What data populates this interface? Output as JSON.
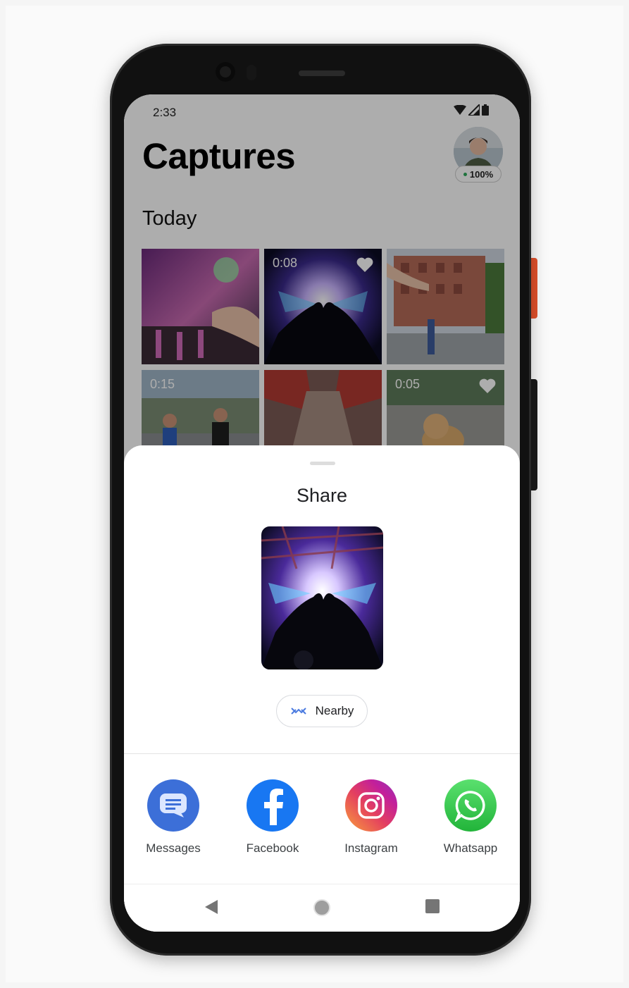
{
  "status": {
    "time": "2:33"
  },
  "app": {
    "title": "Captures",
    "battery": "100%",
    "section": "Today",
    "thumbs": [
      {
        "duration": "",
        "favorite": false
      },
      {
        "duration": "0:08",
        "favorite": true
      },
      {
        "duration": "",
        "favorite": false
      },
      {
        "duration": "0:15",
        "favorite": false
      },
      {
        "duration": "",
        "favorite": false
      },
      {
        "duration": "0:05",
        "favorite": true
      }
    ]
  },
  "share": {
    "title": "Share",
    "nearby_label": "Nearby",
    "apps": [
      {
        "label": "Messages",
        "icon": "messages-icon",
        "color": "#3c6fd8"
      },
      {
        "label": "Facebook",
        "icon": "facebook-icon",
        "color": "#1877f2"
      },
      {
        "label": "Instagram",
        "icon": "instagram-icon",
        "color": "#d6249f"
      },
      {
        "label": "Whatsapp",
        "icon": "whatsapp-icon",
        "color": "#25d366"
      }
    ]
  },
  "nav": {
    "back": "back-icon",
    "home": "home-icon",
    "recents": "recents-icon"
  }
}
